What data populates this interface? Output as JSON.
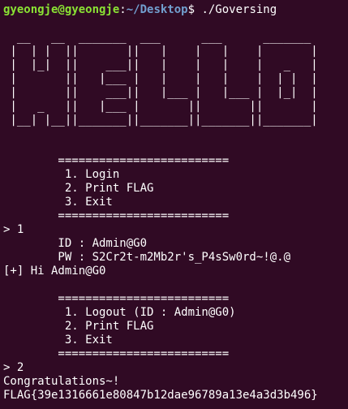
{
  "prompt": {
    "user_host": "gyeongje@gyeongje",
    "separator": ":",
    "path": "~/Desktop",
    "symbol": "$ ",
    "command": "./Goversing"
  },
  "banner": [
    "  __   __  _______  ___      ___      _______ ",
    " |  | |  ||       ||   |    |   |    |       |",
    " |  |_|  ||    ___||   |    |   |    |   _   |",
    " |       ||   |___ |   |    |   |    |  | |  |",
    " |       ||    ___||   |___ |   |___ |  |_|  |",
    " |   _   ||   |___ |       ||       ||       |",
    " |__| |__||_______||_______||_______||_______|"
  ],
  "menu1": {
    "rule": "        =========================",
    "items": [
      "         1. Login",
      "         2. Print FLAG",
      "         3. Exit"
    ]
  },
  "input1": "> 1",
  "login": {
    "id_line": "        ID : Admin@G0",
    "pw_line": "        PW : S2Cr2t-m2Mb2r's_P4sSw0rd~!@.@",
    "greeting": "[+] Hi Admin@G0"
  },
  "menu2": {
    "rule": "        =========================",
    "items": [
      "         1. Logout (ID : Admin@G0)",
      "         2. Print FLAG",
      "         3. Exit"
    ]
  },
  "input2": "> 2",
  "result": {
    "congrats": "Congratulations~!",
    "flag": "FLAG{39e1316661e80847b12dae96789a13e4a3d3b496}"
  }
}
